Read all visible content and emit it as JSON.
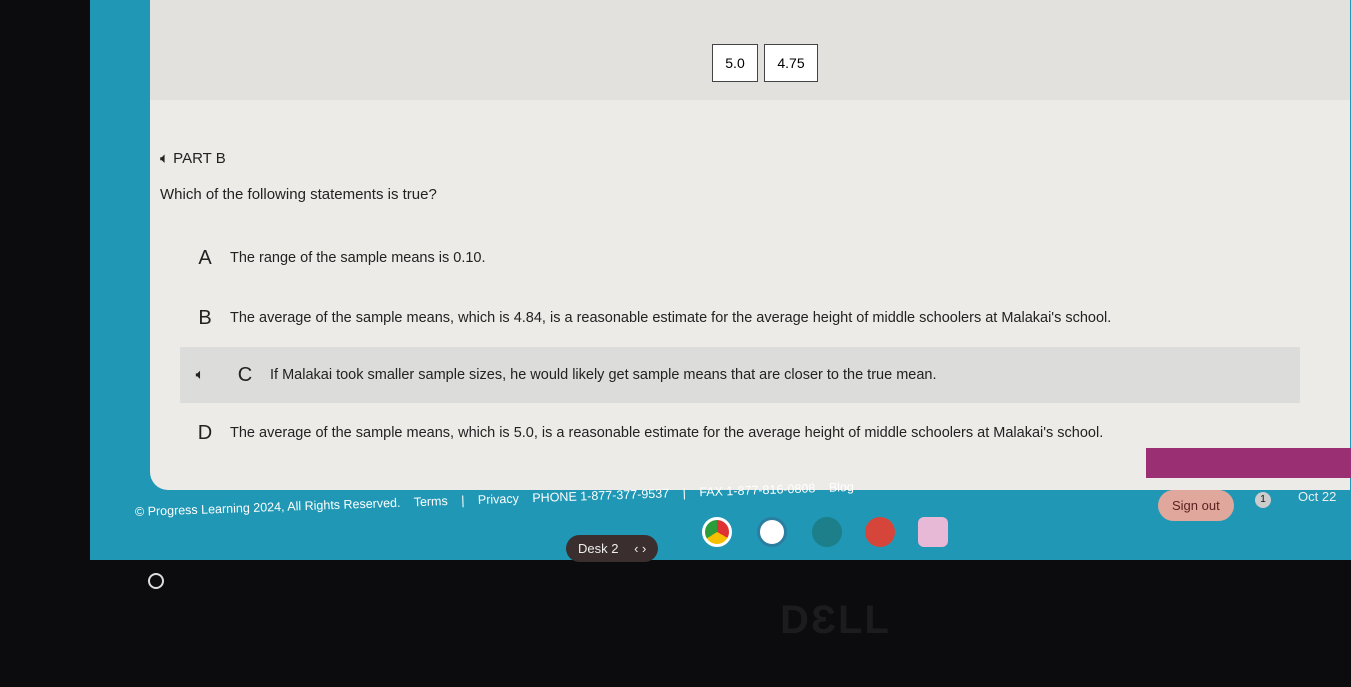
{
  "values": [
    "5.0",
    "4.75"
  ],
  "part_label": "PART B",
  "question": "Which of the following statements is true?",
  "options": [
    {
      "letter": "A",
      "text": "The range of the sample means is 0.10."
    },
    {
      "letter": "B",
      "text": "The average of the sample means, which is 4.84, is a reasonable estimate for the average height of middle schoolers at Malakai's school."
    },
    {
      "letter": "C",
      "text": "If Malakai took smaller sample sizes, he would likely get sample means that are closer to the true mean."
    },
    {
      "letter": "D",
      "text": "The average of the sample means, which is 5.0, is a reasonable estimate for the average height of middle schoolers at Malakai's school."
    }
  ],
  "footer": {
    "copyright": "© Progress Learning 2024, All Rights Reserved.",
    "terms": "Terms",
    "sep": "|",
    "privacy": "Privacy",
    "phone": "PHONE 1-877-377-9537",
    "fax": "FAX 1-877-816-0808",
    "blog": "Blog"
  },
  "shelf": {
    "desk": "Desk 2",
    "nav": "‹ ›",
    "sign_out": "Sign out",
    "notifications": "1",
    "date": "Oct 22"
  },
  "logo": "DELL"
}
